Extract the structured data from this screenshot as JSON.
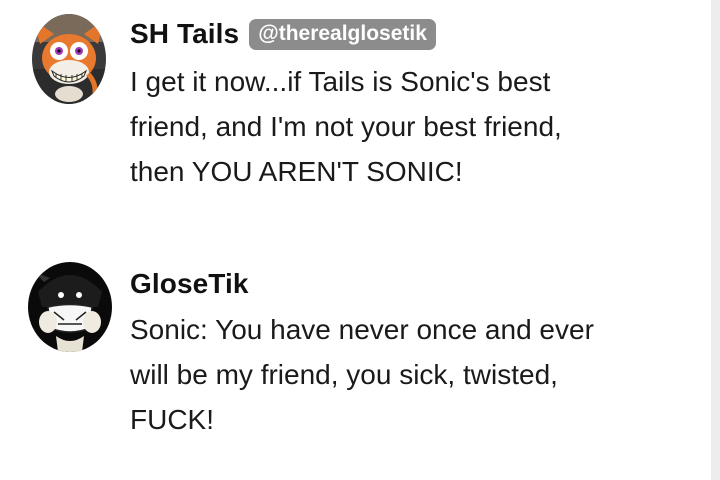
{
  "messages": [
    {
      "author": "SH Tails",
      "handle": "@therealglosetik",
      "avatar_icon": "fox-character-avatar",
      "lines": [
        "I get it now...if Tails is Sonic's best",
        "friend, and I'm not your best friend,",
        "then YOU AREN'T SONIC!"
      ]
    },
    {
      "author": "GloseTik",
      "avatar_icon": "dark-character-avatar",
      "lines": [
        "Sonic: You have never once and ever",
        "will be my friend, you sick, twisted,",
        "FUCK!"
      ]
    }
  ],
  "colors": {
    "handle_badge": "#8c8c8c",
    "text": "#1a1a1a",
    "background": "#ffffff",
    "scroll_strip": "#ededed"
  }
}
